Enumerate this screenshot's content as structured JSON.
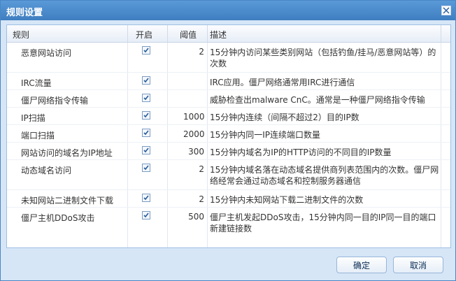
{
  "window": {
    "title": "规则设置",
    "columns": [
      "规则",
      "开启",
      "阈值",
      "描述"
    ]
  },
  "rows": [
    {
      "rule": "恶意网站访问",
      "enabled": true,
      "threshold": "2",
      "desc": "15分钟内访问某些类别网站（包括钓鱼/挂马/恶意网站等）的次数"
    },
    {
      "rule": "IRC流量",
      "enabled": true,
      "threshold": "",
      "desc": "IRC应用。僵尸网络通常用IRC进行通信"
    },
    {
      "rule": "僵尸网络指令传输",
      "enabled": true,
      "threshold": "",
      "desc": "威胁检查出malware CnC。通常是一种僵尸网络指令传输"
    },
    {
      "rule": "IP扫描",
      "enabled": true,
      "threshold": "1000",
      "desc": "15分钟内连续（间隔不超过2）目的IP数"
    },
    {
      "rule": "端口扫描",
      "enabled": true,
      "threshold": "2000",
      "desc": "15分钟内同一IP连续端口数量"
    },
    {
      "rule": "网站访问的域名为IP地址",
      "enabled": true,
      "threshold": "300",
      "desc": "15分钟内域名为IP的HTTP访问的不同目的IP数量"
    },
    {
      "rule": "动态域名访问",
      "enabled": true,
      "threshold": "2",
      "desc": "15分钟内域名落在动态域名提供商列表范围内的次数。僵尸网络经常会通过动态域名和控制服务器通信"
    },
    {
      "rule": "未知网站二进制文件下载",
      "enabled": true,
      "threshold": "2",
      "desc": "15分钟内未知网站下载二进制文件的次数"
    },
    {
      "rule": "僵尸主机DDoS攻击",
      "enabled": true,
      "threshold": "500",
      "desc": "僵尸主机发起DDoS攻击，15分钟内同一目的IP同一目的端口新建链接数"
    }
  ],
  "buttons": {
    "ok": "确定",
    "cancel": "取消"
  }
}
